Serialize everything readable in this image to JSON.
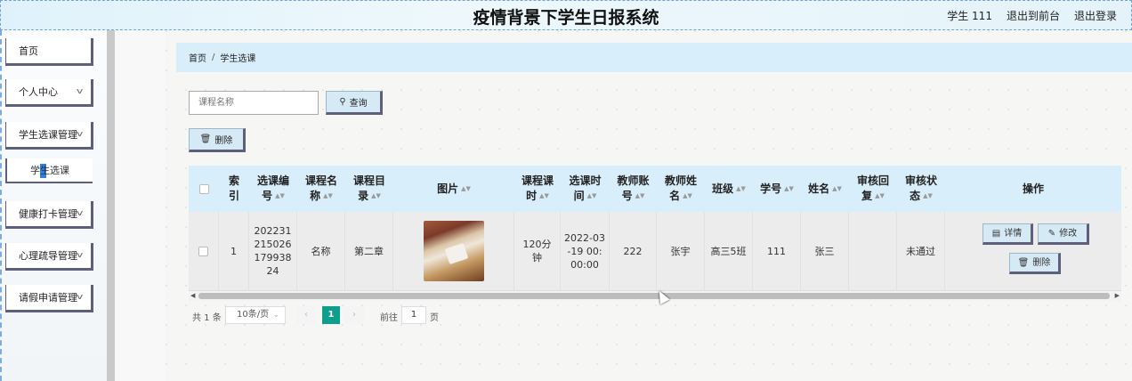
{
  "header": {
    "title": "疫情背景下学生日报系统",
    "user": "学生 111",
    "back_front": "退出到前台",
    "logout": "退出登录"
  },
  "sidebar": {
    "items": [
      {
        "label": "首页"
      },
      {
        "label": "个人中心"
      },
      {
        "label": "学生选课管理"
      },
      {
        "label": "学生选课"
      },
      {
        "label": "健康打卡管理"
      },
      {
        "label": "心理疏导管理"
      },
      {
        "label": "请假申请管理"
      }
    ]
  },
  "breadcrumb": {
    "home": "首页",
    "separator": "/",
    "current": "学生选课"
  },
  "search": {
    "placeholder": "课程名称",
    "button": "查询"
  },
  "toolbar": {
    "delete": "删除"
  },
  "table": {
    "headers": [
      "索引",
      "选课编号",
      "课程名称",
      "课程目录",
      "图片",
      "课程课时",
      "选课时间",
      "教师账号",
      "教师姓名",
      "班级",
      "学号",
      "姓名",
      "审核回复",
      "审核状态",
      "操作"
    ],
    "rows": [
      {
        "index": "1",
        "code": "20223121502617993824",
        "course_name": "名称",
        "catalog": "第二章",
        "hours": "120分钟",
        "time": "2022-03-19 00:00:00",
        "teacher_account": "222",
        "teacher_name": "张宇",
        "class": "高三5班",
        "student_no": "111",
        "name": "张三",
        "reply": "",
        "status": "未通过"
      }
    ],
    "ops": {
      "detail": "详情",
      "edit": "修改",
      "delete": "删除"
    }
  },
  "pagination": {
    "total": "共 1 条",
    "page_size": "10条/页",
    "current": "1",
    "goto_label": "前往",
    "goto_value": "1",
    "page_suffix": "页"
  }
}
